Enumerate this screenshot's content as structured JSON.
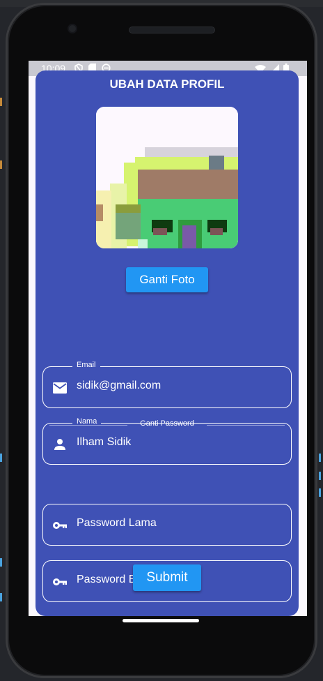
{
  "status_bar": {
    "time": "10:09",
    "left_icons": [
      "do-not-disturb-icon",
      "sd-card-icon",
      "sync-icon"
    ],
    "right_icons": [
      "wifi-icon",
      "signal-icon",
      "battery-icon"
    ]
  },
  "page": {
    "title": "UBAH DATA PROFIL"
  },
  "photo": {
    "description_icon": "profile-photo"
  },
  "buttons": {
    "change_photo": "Ganti Foto",
    "submit": "Submit"
  },
  "fields": {
    "email": {
      "label": "Email",
      "value": "sidik@gmail.com",
      "icon": "mail-icon"
    },
    "name": {
      "label": "Nama",
      "value": "Ilham Sidik",
      "icon": "person-icon"
    },
    "old_password": {
      "placeholder": "Password Lama",
      "icon": "key-icon"
    },
    "new_password": {
      "placeholder": "Password Baru",
      "icon": "key-icon"
    }
  },
  "divider": {
    "label": "Ganti Password"
  },
  "colors": {
    "card": "#3f51b5",
    "button": "#2196f3",
    "text": "#ffffff"
  }
}
